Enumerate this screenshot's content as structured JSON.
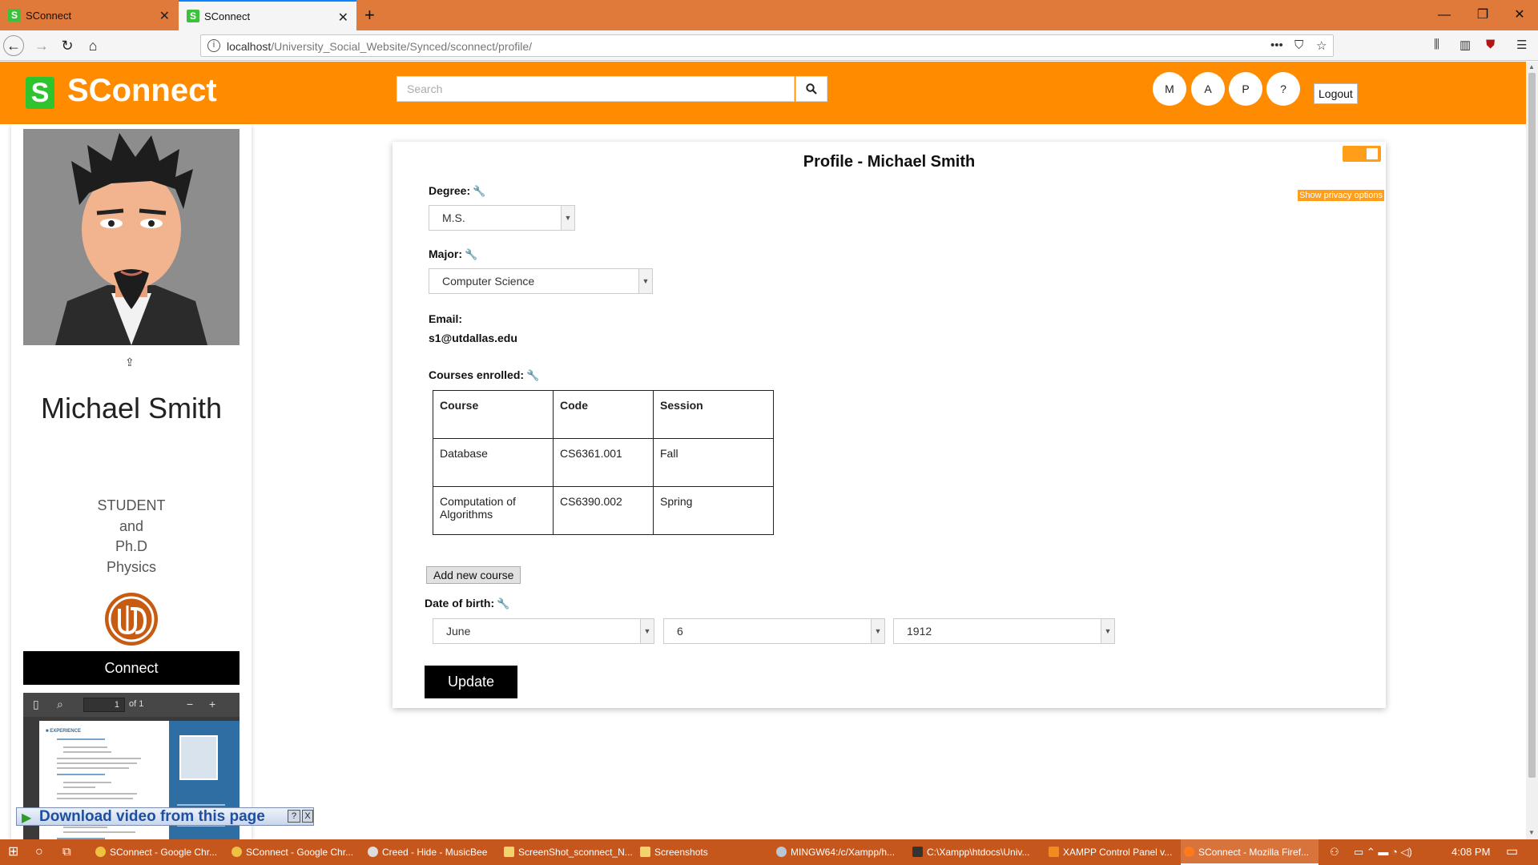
{
  "browser": {
    "tabs": [
      {
        "title": "SConnect",
        "favicon": "S"
      },
      {
        "title": "SConnect",
        "favicon": "S"
      }
    ],
    "url_host": "localhost",
    "url_path": "/University_Social_Website/Synced/sconnect/profile/"
  },
  "header": {
    "logo_letter": "S",
    "logo_text": "SConnect",
    "search_placeholder": "Search",
    "circles": [
      "M",
      "A",
      "P",
      "?"
    ],
    "logout_label": "Logout",
    "colors": {
      "header_bg": "#ff8c00",
      "logo_green": "#2ec42e"
    }
  },
  "sidebar": {
    "name": "Michael Smith",
    "role_lines": [
      "STUDENT",
      "and",
      "Ph.D",
      "Physics"
    ],
    "connect_label": "Connect",
    "pdf_viewer": {
      "page": "1",
      "of": "of 1"
    }
  },
  "profile": {
    "title": "Profile - Michael Smith",
    "privacy_label": "Show privacy options",
    "degree_label": "Degree:",
    "degree_value": "M.S.",
    "major_label": "Major:",
    "major_value": "Computer Science",
    "email_label": "Email:",
    "email_value": "s1@utdallas.edu",
    "courses_label": "Courses enrolled:",
    "courses_headers": [
      "Course",
      "Code",
      "Session"
    ],
    "courses": [
      {
        "course": "Database",
        "code": "CS6361.001",
        "session": "Fall"
      },
      {
        "course": "Computation of Algorithms",
        "code": "CS6390.002",
        "session": "Spring"
      }
    ],
    "add_course_label": "Add new course",
    "dob_label": "Date of birth:",
    "dob_month": "June",
    "dob_day": "6",
    "dob_year": "1912",
    "update_label": "Update"
  },
  "download_banner": {
    "text": "Download video from this page",
    "help": "?",
    "close": "X"
  },
  "taskbar": {
    "items": [
      "SConnect - Google Chr...",
      "SConnect - Google Chr...",
      "Creed - Hide - MusicBee",
      "ScreenShot_sconnect_N...",
      "Screenshots",
      "MINGW64:/c/Xampp/h...",
      "C:\\Xampp\\htdocs\\Univ...",
      "XAMPP Control Panel v...",
      "SConnect - Mozilla Firef..."
    ],
    "time": "4:08 PM"
  }
}
